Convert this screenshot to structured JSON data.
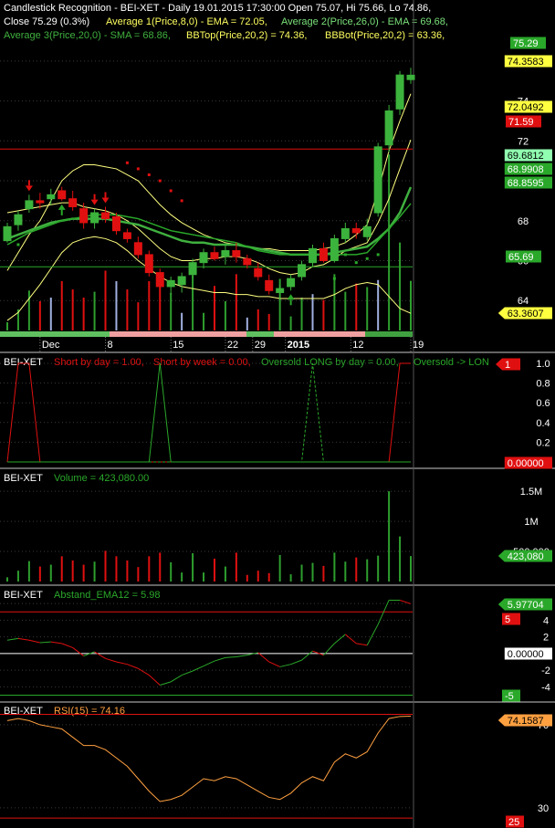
{
  "colors": {
    "background": "#000000",
    "grid": "#3a3a3a",
    "separator": "#c8c8c8",
    "text": "#ffffff",
    "up": "#2e9e2e",
    "down": "#e01010",
    "yellow": "#ffff80",
    "orange": "#ffa040",
    "green": "#2aa82a",
    "red": "#e01010",
    "volume_light": "#a0b0e0"
  },
  "header": {
    "line1_a": "Candlestick Recognition - BEI-XET - Daily 19.01.2015 17:30:00 Open 75.07, Hi 75.66, Lo 74.86,",
    "line2_a": "Close 75.29 (0.3%)",
    "line1_b_ema8": "Average 1(Price,8,0) - EMA = 72.05,",
    "line1_b_ema26": "Average 2(Price,26,0) - EMA = 69.68,",
    "line3_sma": "Average 3(Price,20,0) - SMA = 68.86,",
    "line3_bbtop": "BBTop(Price,20,2) = 74.36,",
    "line3_bbbot": "BBBot(Price,20,2) = 63.36,"
  },
  "x_axis": {
    "labels": [
      {
        "text": "Dec",
        "bar": 3
      },
      {
        "text": "8",
        "bar": 9
      },
      {
        "text": "15",
        "bar": 15
      },
      {
        "text": "22",
        "bar": 20
      },
      {
        "text": "29",
        "bar": 22.5
      },
      {
        "text": "2015",
        "bar": 25.5
      },
      {
        "text": "12",
        "bar": 31.5
      },
      {
        "text": "19",
        "bar": 37
      }
    ]
  },
  "panels": {
    "price": {
      "y_ticks": [
        "76",
        "74",
        "72",
        "70",
        "68",
        "66",
        "64"
      ],
      "badges": {
        "close": "75.29",
        "bbtop": "74.3583",
        "ema8": "72.0492",
        "level": "71.59",
        "ema26": "69.6812",
        "sma": "68.9908",
        "sma2": "68.8595",
        "support": "65.69",
        "bbbot": "63.3607"
      }
    },
    "signals": {
      "title": "BEI-XET",
      "series_a": "Short by day = 1.00,",
      "series_b": "Short by week = 0.00,",
      "series_c": "Oversold LONG by day = 0.00,",
      "series_d": "Oversold -> LON",
      "y_ticks": [
        "1.0",
        "0.8",
        "0.6",
        "0.4",
        "0.2"
      ],
      "badge_top": "1",
      "badge_bottom": "0.00000"
    },
    "volume": {
      "title": "BEI-XET",
      "series": "Volume = 423,080.00",
      "y_ticks": [
        "1.5M",
        "1M",
        "500,000"
      ],
      "badge": "423,080"
    },
    "abstand": {
      "title": "BEI-XET",
      "series": "Abstand_EMA12 = 5.98",
      "y_ticks": [
        "6",
        "4",
        "2",
        "-2",
        "-4"
      ],
      "badge_value": "5.97704",
      "badge_upper": "5",
      "badge_zero": "0.00000",
      "badge_lower": "-5"
    },
    "rsi": {
      "title": "BEI-XET",
      "series": "RSI(15) = 74.16",
      "y_ticks": [
        "70",
        "30"
      ],
      "badge_value": "74.1587",
      "badge_lower": "25"
    }
  },
  "chart_data": [
    {
      "type": "candlestick",
      "title": "Candlestick Recognition - BEI-XET - Daily",
      "ylim": [
        62.5,
        77
      ],
      "ohlc": [
        [
          67.0,
          67.9,
          66.9,
          67.7
        ],
        [
          67.8,
          68.5,
          67.5,
          68.3
        ],
        [
          68.6,
          69.3,
          68.4,
          69.0
        ],
        [
          69.0,
          69.4,
          68.6,
          68.9
        ],
        [
          69.1,
          69.6,
          68.8,
          69.3
        ],
        [
          69.5,
          69.7,
          69.0,
          69.1
        ],
        [
          69.1,
          69.5,
          68.5,
          68.7
        ],
        [
          68.6,
          68.9,
          67.6,
          67.9
        ],
        [
          67.9,
          68.6,
          67.6,
          68.4
        ],
        [
          68.4,
          68.7,
          67.9,
          68.1
        ],
        [
          68.2,
          68.4,
          67.3,
          67.5
        ],
        [
          67.4,
          67.6,
          66.9,
          67.1
        ],
        [
          66.9,
          67.2,
          66.1,
          66.3
        ],
        [
          66.3,
          66.5,
          65.2,
          65.4
        ],
        [
          65.4,
          65.6,
          64.5,
          64.7
        ],
        [
          64.7,
          65.2,
          64.3,
          65.0
        ],
        [
          64.8,
          65.4,
          64.4,
          65.2
        ],
        [
          65.3,
          66.1,
          65.1,
          65.9
        ],
        [
          65.9,
          66.6,
          65.6,
          66.4
        ],
        [
          66.4,
          66.7,
          66.0,
          66.1
        ],
        [
          66.2,
          66.9,
          65.8,
          66.5
        ],
        [
          66.5,
          66.9,
          65.9,
          66.2
        ],
        [
          66.1,
          66.3,
          65.6,
          65.8
        ],
        [
          65.6,
          65.9,
          65.0,
          65.2
        ],
        [
          65.0,
          65.3,
          64.3,
          64.5
        ],
        [
          64.4,
          64.8,
          64.0,
          64.6
        ],
        [
          64.7,
          65.3,
          64.5,
          65.1
        ],
        [
          65.2,
          66.0,
          65.0,
          65.8
        ],
        [
          65.9,
          66.8,
          65.7,
          66.6
        ],
        [
          66.6,
          66.9,
          65.9,
          66.0
        ],
        [
          66.0,
          67.3,
          65.9,
          67.1
        ],
        [
          67.1,
          67.9,
          66.9,
          67.6
        ],
        [
          67.6,
          67.9,
          67.1,
          67.4
        ],
        [
          67.2,
          68.1,
          67.0,
          67.7
        ],
        [
          68.4,
          71.9,
          68.2,
          71.7
        ],
        [
          71.8,
          73.8,
          71.4,
          73.5
        ],
        [
          73.6,
          75.5,
          73.3,
          75.3
        ],
        [
          75.07,
          75.66,
          74.86,
          75.29
        ]
      ],
      "ema8": [
        68.4,
        68.5,
        68.6,
        68.7,
        68.8,
        68.9,
        68.9,
        68.7,
        68.6,
        68.5,
        68.3,
        68.0,
        67.6,
        67.1,
        66.6,
        66.2,
        66.0,
        66.0,
        66.1,
        66.1,
        66.2,
        66.2,
        66.1,
        65.9,
        65.6,
        65.4,
        65.3,
        65.4,
        65.7,
        65.8,
        66.1,
        66.5,
        66.7,
        66.9,
        67.9,
        69.1,
        70.6,
        72.05
      ],
      "ema26": [
        67.1,
        67.3,
        67.5,
        67.7,
        67.9,
        68.0,
        68.1,
        68.1,
        68.1,
        68.1,
        68.0,
        67.9,
        67.8,
        67.6,
        67.4,
        67.2,
        67.0,
        66.9,
        66.9,
        66.8,
        66.8,
        66.8,
        66.7,
        66.6,
        66.5,
        66.4,
        66.3,
        66.3,
        66.3,
        66.3,
        66.4,
        66.5,
        66.6,
        66.7,
        67.1,
        67.6,
        68.4,
        69.68
      ],
      "sma20": [
        66.8,
        67.1,
        67.4,
        67.6,
        67.8,
        68.0,
        68.1,
        68.2,
        68.3,
        68.3,
        68.3,
        68.2,
        68.1,
        67.9,
        67.7,
        67.5,
        67.4,
        67.3,
        67.2,
        67.1,
        67.0,
        66.9,
        66.7,
        66.5,
        66.4,
        66.3,
        66.3,
        66.3,
        66.3,
        66.3,
        66.3,
        66.3,
        66.3,
        66.4,
        67.0,
        67.6,
        68.2,
        68.86
      ],
      "bbtop": [
        65.5,
        66.4,
        67.3,
        68.0,
        69.0,
        70.0,
        70.5,
        70.8,
        70.8,
        70.7,
        70.6,
        70.3,
        70.0,
        69.4,
        68.8,
        68.3,
        67.9,
        67.6,
        67.3,
        67.1,
        66.9,
        66.8,
        66.7,
        66.6,
        66.6,
        66.5,
        66.5,
        66.5,
        66.5,
        66.6,
        66.7,
        66.9,
        67.3,
        67.8,
        69.5,
        71.5,
        73.0,
        74.36
      ],
      "bbbot": [
        63.0,
        63.4,
        64.1,
        64.8,
        65.6,
        66.4,
        66.9,
        67.1,
        67.2,
        67.1,
        66.9,
        66.5,
        66.0,
        65.6,
        65.2,
        64.9,
        64.7,
        64.6,
        64.5,
        64.4,
        64.4,
        64.3,
        64.3,
        64.2,
        64.2,
        64.1,
        64.1,
        64.1,
        64.1,
        64.1,
        64.3,
        64.6,
        64.8,
        64.9,
        64.8,
        64.2,
        63.6,
        63.36
      ],
      "resistance": 71.59,
      "support": 65.69
    },
    {
      "type": "line",
      "title": "Signals",
      "ylim": [
        0,
        1.1
      ],
      "short_by_day": [
        0,
        1,
        1,
        0,
        0,
        0,
        0,
        0,
        0,
        0,
        0,
        0,
        0,
        0,
        0,
        0,
        0,
        0,
        0,
        0,
        0,
        0,
        0,
        0,
        0,
        0,
        0,
        0,
        0,
        0,
        0,
        0,
        0,
        0,
        0,
        0,
        1,
        1
      ],
      "short_by_week": [
        0,
        0,
        0,
        0,
        0,
        0,
        0,
        0,
        0,
        0,
        0,
        0,
        0,
        0,
        1,
        0,
        0,
        0,
        0,
        0,
        0,
        0,
        0,
        0,
        0,
        0,
        0,
        0,
        0,
        0,
        0,
        0,
        0,
        0,
        0,
        0,
        0,
        0
      ],
      "oversold_long_by_day": [
        0,
        0,
        0,
        0,
        0,
        0,
        0,
        0,
        0,
        0,
        0,
        0,
        0,
        0,
        0,
        0,
        0,
        0,
        0,
        0,
        0,
        0,
        0,
        0,
        0,
        0,
        0,
        0,
        1,
        0,
        0,
        0,
        0,
        0,
        0,
        0,
        0,
        0
      ]
    },
    {
      "type": "bar",
      "title": "Volume",
      "ylim": [
        0,
        1700000
      ],
      "values": [
        70000,
        180000,
        340000,
        250000,
        280000,
        420000,
        350000,
        280000,
        330000,
        510000,
        420000,
        350000,
        240000,
        420000,
        480000,
        320000,
        150000,
        470000,
        150000,
        380000,
        250000,
        480000,
        110000,
        180000,
        140000,
        440000,
        120000,
        280000,
        310000,
        260000,
        480000,
        330000,
        400000,
        370000,
        430000,
        1500000,
        750000,
        423080
      ]
    },
    {
      "type": "line",
      "title": "Abstand_EMA12",
      "ylim": [
        -5.5,
        7
      ],
      "values": [
        1.6,
        1.8,
        1.6,
        1.3,
        1.4,
        1.2,
        0.7,
        -0.3,
        0.2,
        -0.6,
        -1.0,
        -1.3,
        -1.8,
        -2.6,
        -3.8,
        -3.4,
        -2.6,
        -2.1,
        -1.5,
        -0.9,
        -0.5,
        -0.4,
        -0.2,
        0.1,
        -1.0,
        -1.6,
        -1.3,
        -0.8,
        0.3,
        -0.2,
        1.2,
        2.3,
        1.2,
        1.0,
        3.5,
        6.4,
        6.4,
        5.98
      ],
      "upper": 5,
      "lower": -5
    },
    {
      "type": "line",
      "title": "RSI(15)",
      "ylim": [
        22,
        77
      ],
      "values": [
        72,
        73,
        72,
        70,
        69,
        68,
        64,
        60,
        60,
        58,
        54,
        50,
        44,
        38,
        33,
        34,
        36,
        40,
        44,
        43,
        45,
        44,
        41,
        38,
        35,
        34,
        37,
        42,
        45,
        43,
        52,
        56,
        54,
        57,
        66,
        73,
        74,
        74.16
      ],
      "upper": 75,
      "lower": 25
    }
  ]
}
